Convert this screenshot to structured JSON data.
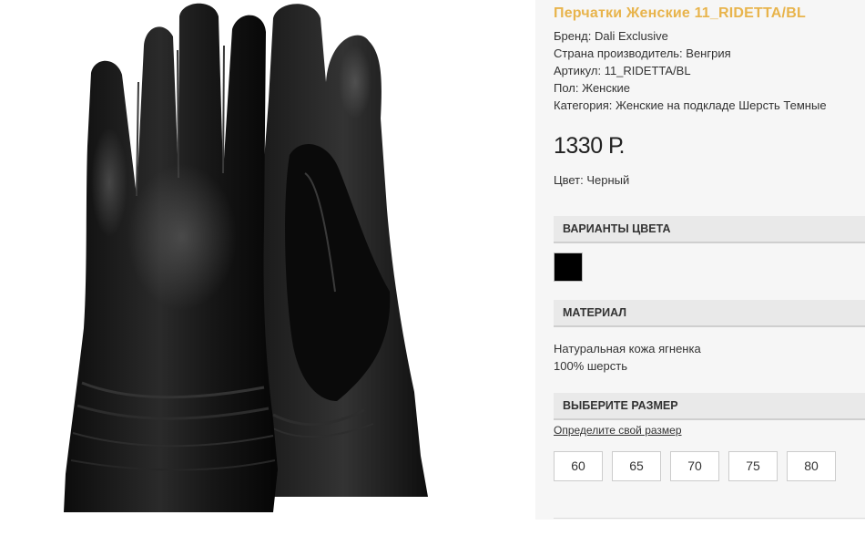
{
  "product": {
    "title": "Перчатки Женские 11_RIDETTA/BL",
    "image_alt": "black-leather-gloves",
    "specs": [
      "Бренд: Dali Exclusive",
      "Страна производитель: Венгрия",
      "Артикул: 11_RIDETTA/BL",
      "Пол: Женские",
      "Категория: Женские на подкладе Шерсть Темные"
    ],
    "price": "1330 Р.",
    "color_line": "Цвет: Черный"
  },
  "sections": {
    "colors_header": "ВАРИАНТЫ ЦВЕТА",
    "material_header": "МАТЕРИАЛ",
    "size_header": "ВЫБЕРИТЕ РАЗМЕР"
  },
  "color_variants": [
    {
      "name": "Черный",
      "hex": "#000000"
    }
  ],
  "material": [
    "Натуральная кожа ягненка",
    "100% шерсть"
  ],
  "size_guide_link": "Определите свой размер",
  "sizes": [
    "60",
    "65",
    "70",
    "75",
    "80"
  ],
  "colors": {
    "title": "#e8b44c",
    "panel_bg": "#f6f6f6",
    "header_bg": "#e9e9e9"
  }
}
